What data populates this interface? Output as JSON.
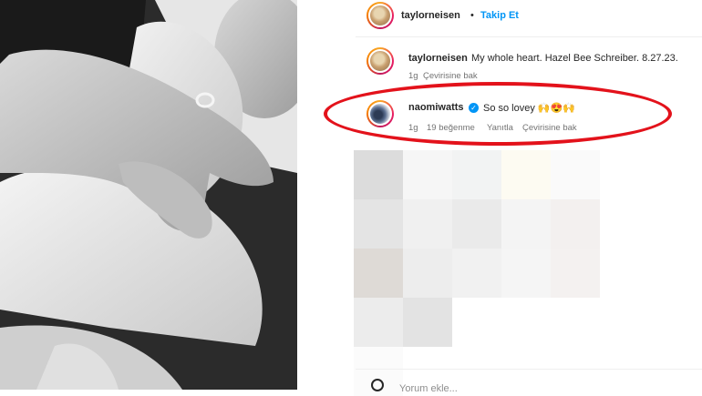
{
  "post": {
    "author": "taylorneisen",
    "follow_label": "Takip Et",
    "separator": "•"
  },
  "caption": {
    "username": "taylorneisen",
    "text": "My whole heart. Hazel Bee Schreiber. 8.27.23.",
    "time": "1g",
    "translate_label": "Çevirisine bak"
  },
  "comment": {
    "username": "naomiwatts",
    "verified": true,
    "text": "So so lovey 🙌😍🙌",
    "time": "1g",
    "likes": "19 beğenme",
    "reply_label": "Yanıtla",
    "translate_label": "Çevirisine bak"
  },
  "add_comment": {
    "placeholder": "Yorum ekle..."
  },
  "colors": {
    "highlight": "#e3121b",
    "link": "#0095f6",
    "text": "#262626",
    "muted": "#737373"
  },
  "icons": {
    "verified": "verified-badge-icon",
    "comment": "emoji-icon"
  }
}
